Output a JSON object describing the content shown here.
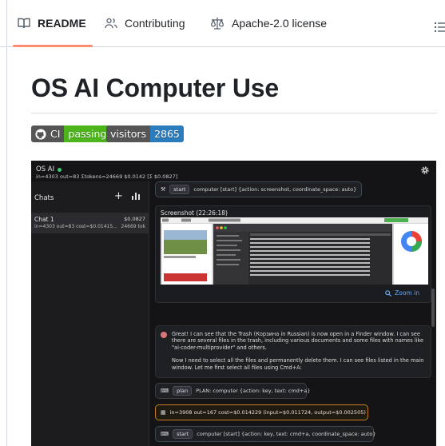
{
  "tabs": [
    {
      "label": "README",
      "icon": "book-icon",
      "active": true
    },
    {
      "label": "Contributing",
      "icon": "people-icon"
    },
    {
      "label": "Apache-2.0 license",
      "icon": "law-icon"
    }
  ],
  "title": "OS AI Computer Use",
  "badges": {
    "ci": {
      "label": "CI",
      "value": "passing",
      "color": "#4cb51c"
    },
    "visitors": {
      "label": "visitors",
      "value": "2865",
      "color": "#2b7cbd"
    }
  },
  "app": {
    "title": "OS AI",
    "stats": "in=4303 out=83  Σtokens=24669  $0.0142  [Σ $0.0827]",
    "sidebar": {
      "heading": "Chats",
      "chat": {
        "name": "Chat 1",
        "cost": "$0.0827",
        "meta": "in=4303 out=83  cost=$0.01415...",
        "tokens": "24669 tok"
      }
    },
    "messages": {
      "first_tool": {
        "tag": "start",
        "text": "computer [start] {action: screenshot, coordinate_space: auto}"
      },
      "screenshot_title": "Screenshot (22:26:18)",
      "zoom": "Zoom in",
      "assistant_p1": "Great! I can see that the Trash (Корзина in Russian) is now open in a Finder window. I can see there are several files in the trash, including various documents and some files with names like \"ai-coder-multiprovider\" and others.",
      "assistant_p2": "Now I need to select all the files and permanently delete them. I can see files listed in the main window. Let me first select all files using Cmd+A:",
      "plan": {
        "tag": "plan",
        "text": "PLAN: computer {action: key, text: cmd+a}"
      },
      "usage": {
        "text": "in=3908 out=167  cost=$0.014229 (input=$0.011724, output=$0.002505)"
      },
      "start2": {
        "tag": "start",
        "text": "computer [start] {action: key, text: cmd+a, coordinate_space: auto}"
      }
    }
  }
}
